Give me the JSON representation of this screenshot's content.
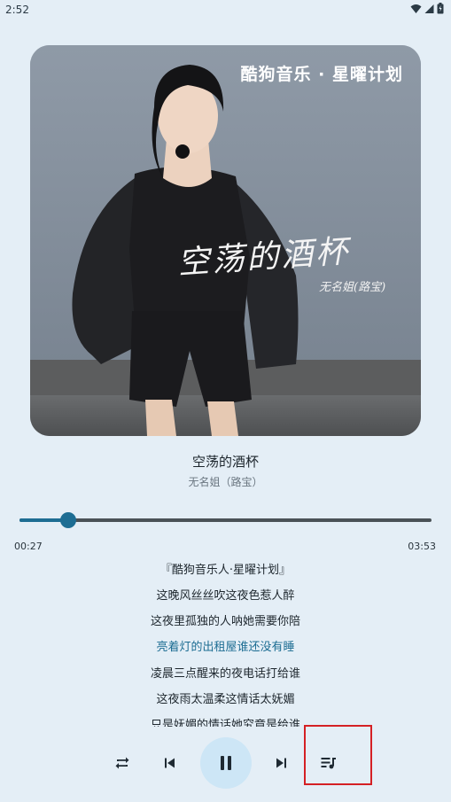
{
  "status_bar": {
    "time": "2:52"
  },
  "album": {
    "brand_text": "酷狗音乐 · 星曜计划",
    "cover_title": "空荡的酒杯",
    "cover_artist": "无名姐(路宝)"
  },
  "song": {
    "title": "空荡的酒杯",
    "artist": "无名姐（路宝）"
  },
  "progress": {
    "elapsed": "00:27",
    "total": "03:53",
    "fraction": 0.119
  },
  "lyrics": {
    "lines": [
      "『酷狗音乐人·星曜计划』",
      "这晚风丝丝吹这夜色惹人醉",
      "这夜里孤独的人呐她需要你陪",
      "亮着灯的出租屋谁还没有睡",
      "凌晨三点醒来的夜电话打给谁",
      "这夜雨太温柔这情话太妩媚",
      "只是妩媚的情话她究竟是给谁"
    ],
    "active_index": 3
  },
  "controls": {
    "repeat_icon": "repeat-icon",
    "previous_icon": "skip-previous-icon",
    "play_pause_icon": "pause-icon",
    "next_icon": "skip-next-icon",
    "playlist_icon": "playlist-icon"
  },
  "colors": {
    "accent": "#1d6d93",
    "play_button_bg": "#cde6f6",
    "highlight": "#d42024",
    "background": "#e4eef6"
  }
}
